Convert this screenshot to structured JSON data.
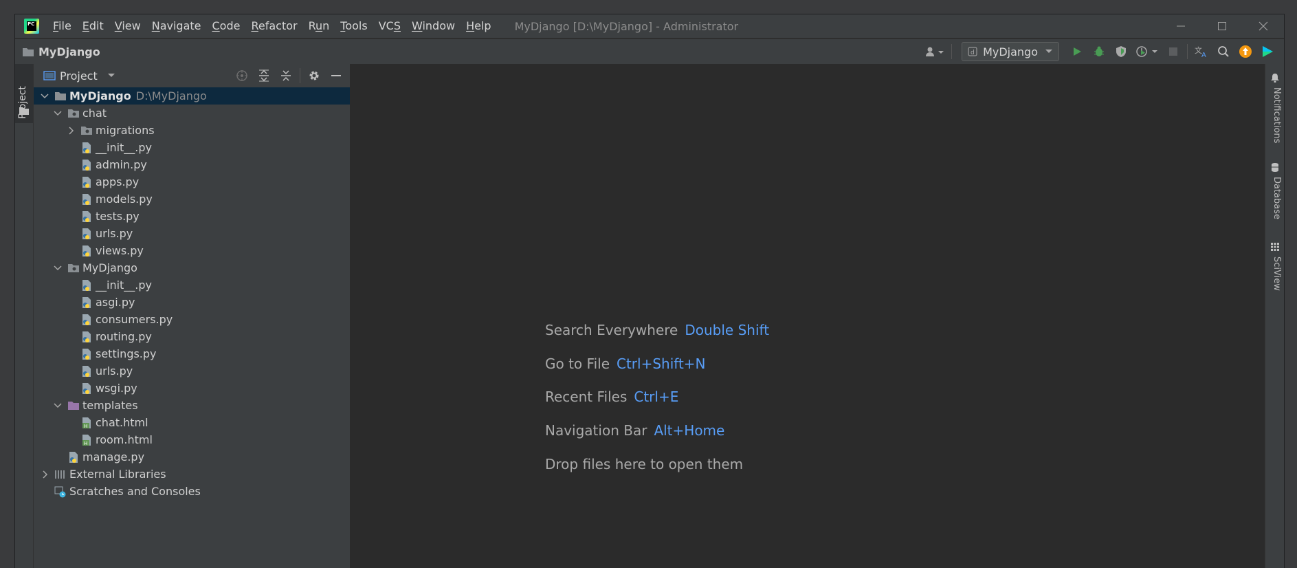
{
  "titlebar": {
    "menu": [
      "File",
      "Edit",
      "View",
      "Navigate",
      "Code",
      "Refactor",
      "Run",
      "Tools",
      "VCS",
      "Window",
      "Help"
    ],
    "menu_mnemonics": [
      "F",
      "E",
      "V",
      "N",
      "C",
      "R",
      "u",
      "T",
      "S",
      "W",
      "H"
    ],
    "window_title": "MyDjango [D:\\MyDjango] - Administrator"
  },
  "navbar": {
    "project_name": "MyDjango",
    "run_config": "MyDjango"
  },
  "left_stripe": {
    "tab_label": "Project"
  },
  "project_panel": {
    "title": "Project",
    "tree": [
      {
        "label": "MyDjango",
        "path": "D:\\MyDjango",
        "depth": 0,
        "type": "root",
        "expanded": true,
        "selected": true
      },
      {
        "label": "chat",
        "depth": 1,
        "type": "package",
        "expanded": true
      },
      {
        "label": "migrations",
        "depth": 2,
        "type": "package",
        "expanded": false
      },
      {
        "label": "__init__.py",
        "depth": 2,
        "type": "py"
      },
      {
        "label": "admin.py",
        "depth": 2,
        "type": "py"
      },
      {
        "label": "apps.py",
        "depth": 2,
        "type": "py"
      },
      {
        "label": "models.py",
        "depth": 2,
        "type": "py"
      },
      {
        "label": "tests.py",
        "depth": 2,
        "type": "py"
      },
      {
        "label": "urls.py",
        "depth": 2,
        "type": "py"
      },
      {
        "label": "views.py",
        "depth": 2,
        "type": "py"
      },
      {
        "label": "MyDjango",
        "depth": 1,
        "type": "package",
        "expanded": true
      },
      {
        "label": "__init__.py",
        "depth": 2,
        "type": "py"
      },
      {
        "label": "asgi.py",
        "depth": 2,
        "type": "py"
      },
      {
        "label": "consumers.py",
        "depth": 2,
        "type": "py"
      },
      {
        "label": "routing.py",
        "depth": 2,
        "type": "py"
      },
      {
        "label": "settings.py",
        "depth": 2,
        "type": "py"
      },
      {
        "label": "urls.py",
        "depth": 2,
        "type": "py"
      },
      {
        "label": "wsgi.py",
        "depth": 2,
        "type": "py"
      },
      {
        "label": "templates",
        "depth": 1,
        "type": "templates",
        "expanded": true
      },
      {
        "label": "chat.html",
        "depth": 2,
        "type": "html"
      },
      {
        "label": "room.html",
        "depth": 2,
        "type": "html"
      },
      {
        "label": "manage.py",
        "depth": 1,
        "type": "py"
      },
      {
        "label": "External Libraries",
        "depth": 0,
        "type": "libs",
        "expanded": false
      },
      {
        "label": "Scratches and Consoles",
        "depth": 0,
        "type": "scratches"
      }
    ]
  },
  "editor": {
    "hints": [
      {
        "label": "Search Everywhere",
        "key": "Double Shift"
      },
      {
        "label": "Go to File",
        "key": "Ctrl+Shift+N"
      },
      {
        "label": "Recent Files",
        "key": "Ctrl+E"
      },
      {
        "label": "Navigation Bar",
        "key": "Alt+Home"
      },
      {
        "label": "Drop files here to open them",
        "key": ""
      }
    ]
  },
  "right_stripe": {
    "tabs": [
      "Notifications",
      "Database",
      "SciView"
    ]
  },
  "colors": {
    "background": "#2b2b2b",
    "panel": "#3c3f41",
    "selection": "#0d293e",
    "shortcut": "#589df6",
    "run_green": "#499c54",
    "update_orange": "#f49810"
  }
}
